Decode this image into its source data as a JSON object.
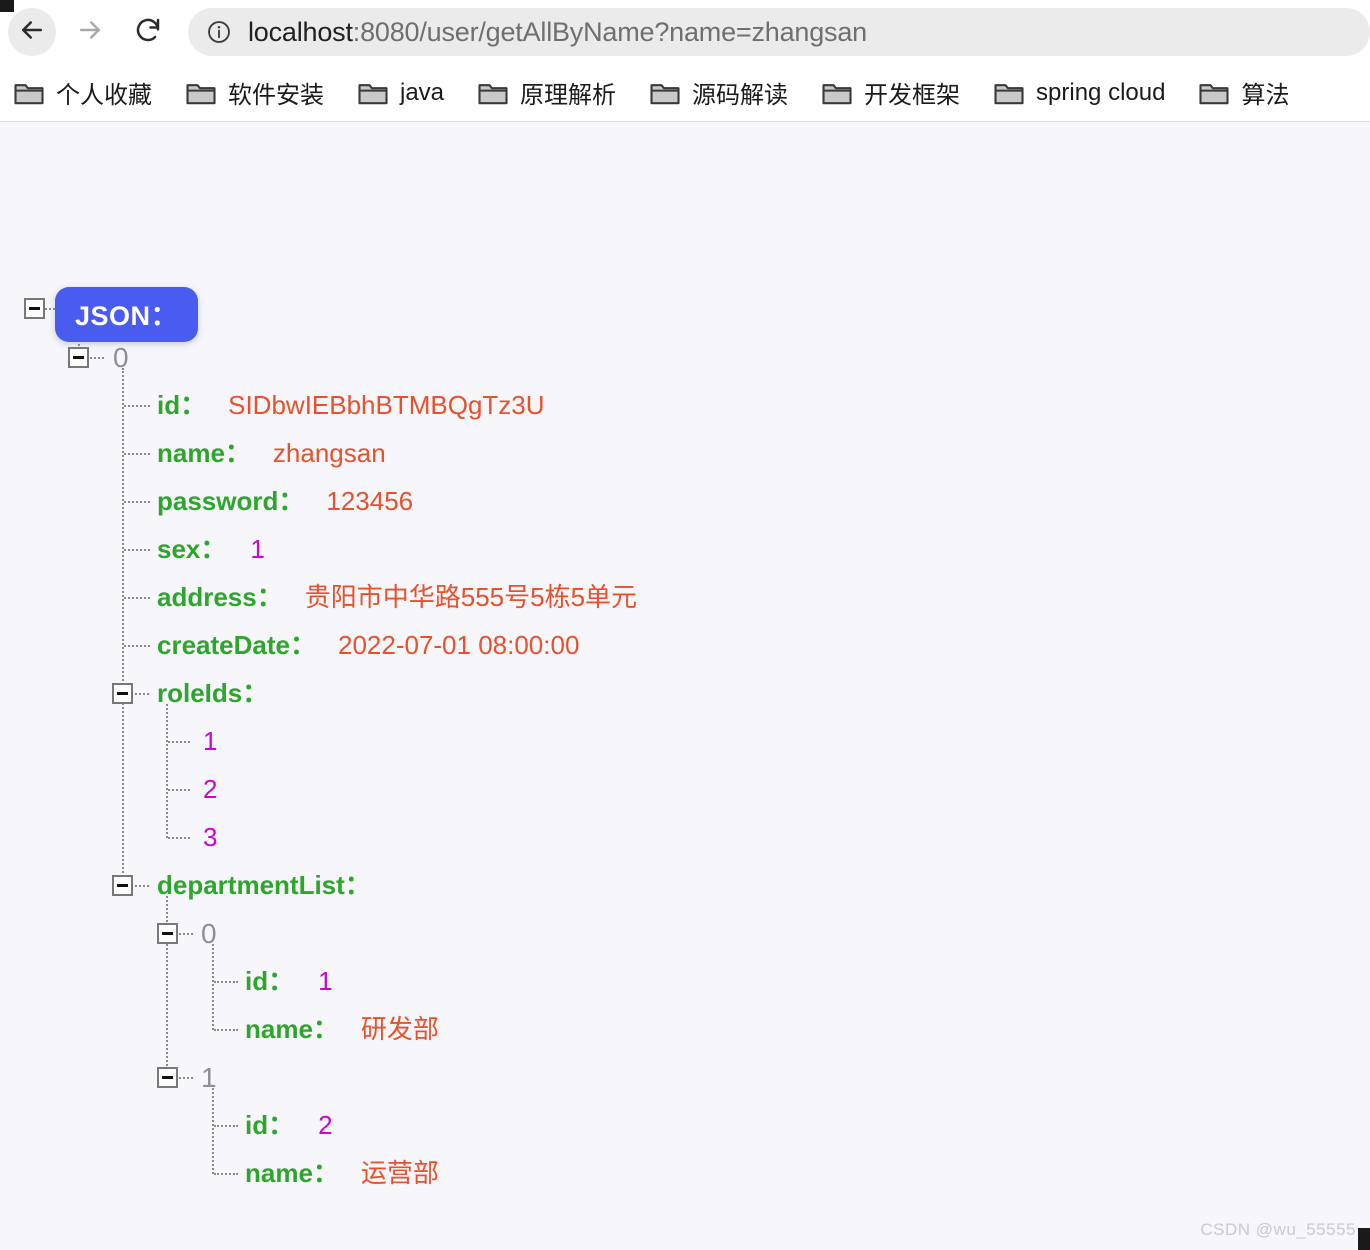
{
  "browser": {
    "nav": {
      "back": "back-arrow",
      "forward": "forward-arrow",
      "reload": "reload-arrow"
    },
    "omnibox": {
      "info_icon": "info-circle-icon",
      "url_host": "localhost",
      "url_rest": ":8080/user/getAllByName?name=zhangsan",
      "full_url": "localhost:8080/user/getAllByName?name=zhangsan"
    },
    "bookmarks": [
      {
        "label": "个人收藏",
        "icon": "folder-icon"
      },
      {
        "label": "软件安装",
        "icon": "folder-icon"
      },
      {
        "label": "java",
        "icon": "folder-icon"
      },
      {
        "label": "原理解析",
        "icon": "folder-icon"
      },
      {
        "label": "源码解读",
        "icon": "folder-icon"
      },
      {
        "label": "开发框架",
        "icon": "folder-icon"
      },
      {
        "label": "spring cloud",
        "icon": "folder-icon"
      },
      {
        "label": "算法",
        "icon": "folder-icon"
      }
    ]
  },
  "viewer": {
    "root_label": "JSON：",
    "root_index": "0",
    "fields": {
      "id_key": "id：",
      "id_value": "SIDbwIEBbhBTMBQgTz3U",
      "name_key": "name：",
      "name_value": "zhangsan",
      "password_key": "password：",
      "password_value": "123456",
      "sex_key": "sex：",
      "sex_value": "1",
      "address_key": "address：",
      "address_value": "贵阳市中华路555号5栋5单元",
      "createdate_key": "createDate：",
      "createdate_value": "2022-07-01 08:00:00",
      "roleids_key": "roleIds：",
      "departmentlist_key": "departmentList："
    },
    "roleIds": [
      "1",
      "2",
      "3"
    ],
    "departments": [
      {
        "index": "0",
        "id_key": "id：",
        "id_value": "1",
        "name_key": "name：",
        "name_value": "研发部"
      },
      {
        "index": "1",
        "id_key": "id：",
        "id_value": "2",
        "name_key": "name：",
        "name_value": "运营部"
      }
    ]
  },
  "watermark": "CSDN @wu_55555",
  "colors": {
    "key": "#2ea62e",
    "string": "#e8512c",
    "number": "#cc06cc",
    "index": "#8f8f93",
    "badge": "#4a5bf0",
    "page_bg": "#f6f6fb"
  }
}
